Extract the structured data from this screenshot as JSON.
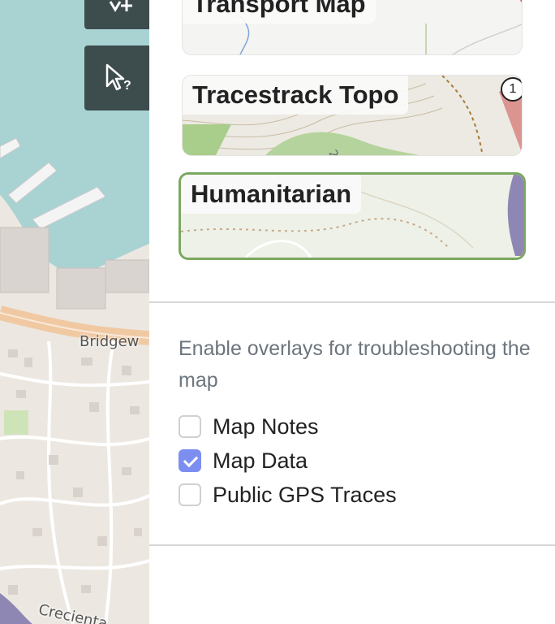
{
  "map": {
    "labels": {
      "street": "Bridgew",
      "crecienta": "Crecienta"
    },
    "colors": {
      "water": "#a9d3d3",
      "land": "#ece8e1",
      "pier": "#eaeaea",
      "road": "#f0b98a",
      "control_bg": "#3d4c4d"
    }
  },
  "controls": {
    "add_icon": "plus-icon",
    "query_icon": "query-cursor-icon"
  },
  "layers": [
    {
      "id": "transport",
      "label": "Transport Map",
      "selected": false
    },
    {
      "id": "tracestrack",
      "label": "Tracestrack Topo",
      "selected": false,
      "badge": "1"
    },
    {
      "id": "humanitarian",
      "label": "Humanitarian",
      "selected": true
    }
  ],
  "overlays": {
    "description": "Enable overlays for troubleshooting the map",
    "items": [
      {
        "label": "Map Notes",
        "checked": false
      },
      {
        "label": "Map Data",
        "checked": true
      },
      {
        "label": "Public GPS Traces",
        "checked": false
      }
    ]
  },
  "colors": {
    "selected_border": "#7ba860",
    "checkbox_checked": "#7c8ef0",
    "description_text": "#6c757d"
  }
}
